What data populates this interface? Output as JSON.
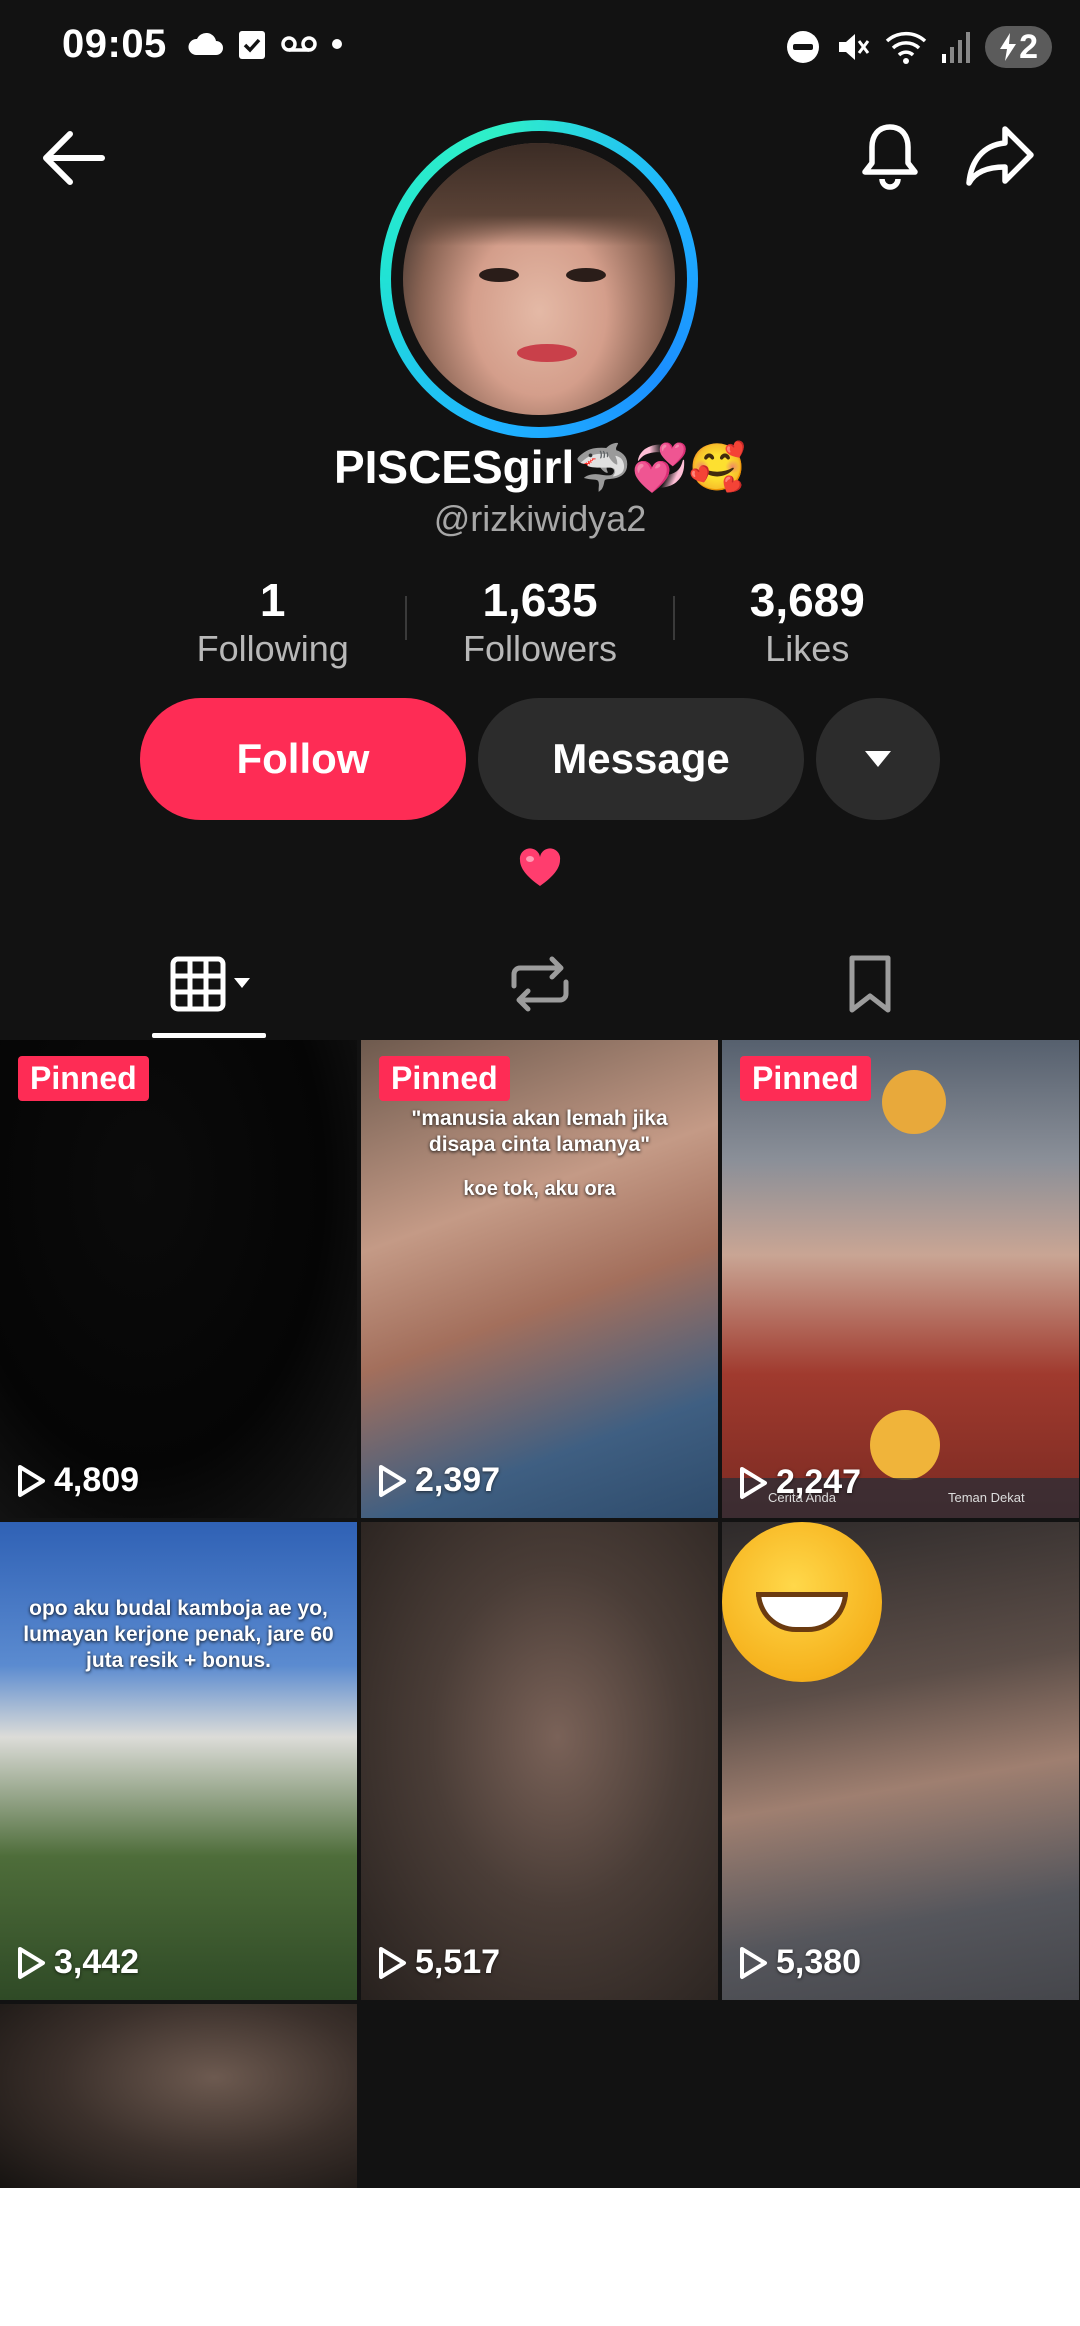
{
  "status_bar": {
    "time": "09:05",
    "battery": "2"
  },
  "profile": {
    "display_name": "PISCESgirl🦈💞🥰",
    "handle": "@rizkiwidya2",
    "bio_emoji": "❤️"
  },
  "stats": [
    {
      "value": "1",
      "label": "Following"
    },
    {
      "value": "1,635",
      "label": "Followers"
    },
    {
      "value": "3,689",
      "label": "Likes"
    }
  ],
  "actions": {
    "follow": "Follow",
    "message": "Message"
  },
  "tabs": [
    "videos-grid-icon",
    "repost-icon",
    "bookmark-icon"
  ],
  "videos": [
    {
      "pinned": "Pinned",
      "views": "4,809"
    },
    {
      "pinned": "Pinned",
      "views": "2,397",
      "caption": "\"manusia akan lemah jika disapa cinta lamanya\"",
      "caption2": "koe tok, aku ora"
    },
    {
      "pinned": "Pinned",
      "views": "2,247",
      "footer_left": "Cerita Anda",
      "footer_right": "Teman Dekat"
    },
    {
      "views": "3,442",
      "caption": "opo aku budal kamboja ae yo, lumayan kerjone penak, jare 60 juta resik + bonus."
    },
    {
      "views": "5,517"
    },
    {
      "views": "5,380"
    },
    {}
  ],
  "colors": {
    "accent": "#fe2c55",
    "background": "#121212",
    "button_dark": "#2c2c2c"
  }
}
